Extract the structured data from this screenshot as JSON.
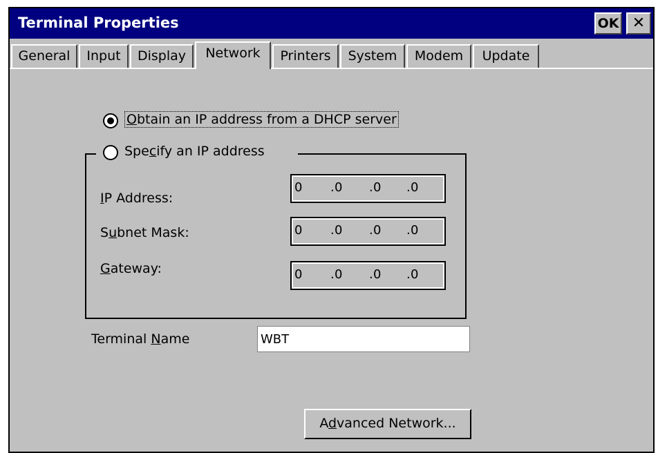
{
  "window": {
    "title": "Terminal Properties",
    "ok_label": "OK",
    "close_label": "✕"
  },
  "tabs": [
    {
      "label": "General",
      "active": false
    },
    {
      "label": "Input",
      "active": false
    },
    {
      "label": "Display",
      "active": false
    },
    {
      "label": "Network",
      "active": true
    },
    {
      "label": "Printers",
      "active": false
    },
    {
      "label": "System",
      "active": false
    },
    {
      "label": "Modem",
      "active": false
    },
    {
      "label": "Update",
      "active": false
    }
  ],
  "network": {
    "dhcp": {
      "label_pre": "",
      "label_mnemonic": "O",
      "label_post": "btain an IP address from a DHCP server",
      "selected": true
    },
    "specify": {
      "label_pre": "Spe",
      "label_mnemonic": "c",
      "label_post": "ify an IP address",
      "selected": false
    },
    "ip_address": {
      "label_pre": "",
      "label_mnemonic": "I",
      "label_post": "P Address:",
      "octets": [
        "0",
        "0",
        "0",
        "0"
      ]
    },
    "subnet_mask": {
      "label_pre": "S",
      "label_mnemonic": "u",
      "label_post": "bnet Mask:",
      "octets": [
        "0",
        "0",
        "0",
        "0"
      ]
    },
    "gateway": {
      "label_pre": "",
      "label_mnemonic": "G",
      "label_post": "ateway:",
      "octets": [
        "0",
        "0",
        "0",
        "0"
      ]
    },
    "terminal_name": {
      "label_pre": "Terminal ",
      "label_mnemonic": "N",
      "label_post": "ame",
      "value": "WBT"
    },
    "advanced_button": {
      "label_pre": "A",
      "label_mnemonic": "d",
      "label_post": "vanced Network..."
    }
  },
  "colors": {
    "titlebar": "#000080",
    "face": "#c0c0c0"
  }
}
